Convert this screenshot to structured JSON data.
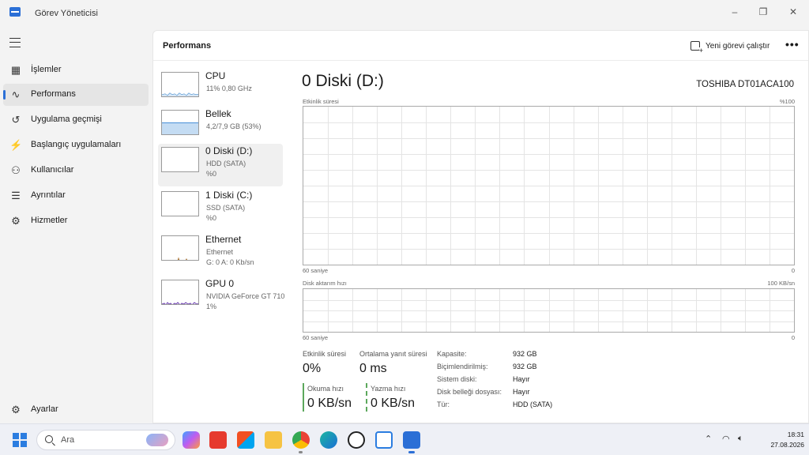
{
  "window": {
    "title": "Görev Yöneticisi",
    "controls": [
      "minimize-icon",
      "maximize-icon",
      "close-icon"
    ]
  },
  "nav": {
    "items": [
      {
        "label": "İşlemler",
        "icon": "processes-icon"
      },
      {
        "label": "Performans",
        "icon": "performance-icon",
        "active": true
      },
      {
        "label": "Uygulama geçmişi",
        "icon": "history-icon"
      },
      {
        "label": "Başlangıç uygulamaları",
        "icon": "startup-icon"
      },
      {
        "label": "Kullanıcılar",
        "icon": "users-icon"
      },
      {
        "label": "Ayrıntılar",
        "icon": "details-icon"
      },
      {
        "label": "Hizmetler",
        "icon": "services-icon"
      }
    ],
    "settings": "Ayarlar"
  },
  "header": {
    "title": "Performans",
    "run_task": "Yeni görevi çalıştır",
    "more": "•••"
  },
  "devices": [
    {
      "name": "CPU",
      "line2": "11%  0,80 GHz",
      "line3": "",
      "color": "#2a7cc7"
    },
    {
      "name": "Bellek",
      "line2": "4,2/7,9 GB (53%)",
      "line3": "",
      "color": "#4a90d9",
      "fill": 0.53
    },
    {
      "name": "0 Diski (D:)",
      "line2": "HDD (SATA)",
      "line3": "%0",
      "color": "#5ca85c",
      "active": true
    },
    {
      "name": "1 Diski (C:)",
      "line2": "SSD (SATA)",
      "line3": "%0",
      "color": "#5ca85c"
    },
    {
      "name": "Ethernet",
      "line2": "Ethernet",
      "line3": "G: 0  A: 0 Kb/sn",
      "color": "#b07a3b"
    },
    {
      "name": "GPU 0",
      "line2": "NVIDIA GeForce GT 710",
      "line3": "1%",
      "color": "#6c3fb0"
    }
  ],
  "detail": {
    "title": "0 Diski (D:)",
    "model": "TOSHIBA DT01ACA100",
    "graph1": {
      "label": "Etkinlik süresi",
      "max": "%100",
      "xlabel": "60 saniye",
      "min": "0"
    },
    "graph2": {
      "label": "Disk aktarım hızı",
      "max": "100 KB/sn",
      "xlabel": "60 saniye",
      "min": "0"
    },
    "stats": {
      "active_time_label": "Etkinlik süresi",
      "active_time_value": "0%",
      "avg_response_label": "Ortalama yanıt süresi",
      "avg_response_value": "0 ms",
      "read_label": "Okuma hızı",
      "read_value": "0 KB/sn",
      "write_label": "Yazma hızı",
      "write_value": "0 KB/sn"
    },
    "properties": [
      {
        "key": "Kapasite:",
        "value": "932 GB"
      },
      {
        "key": "Biçimlendirilmiş:",
        "value": "932 GB"
      },
      {
        "key": "Sistem diski:",
        "value": "Hayır"
      },
      {
        "key": "Disk belleği dosyası:",
        "value": "Hayır"
      },
      {
        "key": "Tür:",
        "value": "HDD (SATA)"
      }
    ],
    "graph_color": "#5ca85c"
  },
  "taskbar": {
    "search_placeholder": "Ara",
    "apps": [
      "copilot-icon",
      "anydesk-icon",
      "store-icon",
      "file-explorer-icon",
      "chrome-icon",
      "edge-icon",
      "chatgpt-icon",
      "snipping-tool-icon",
      "task-manager-icon"
    ],
    "time": "18:31",
    "date": "27.08.2026"
  }
}
